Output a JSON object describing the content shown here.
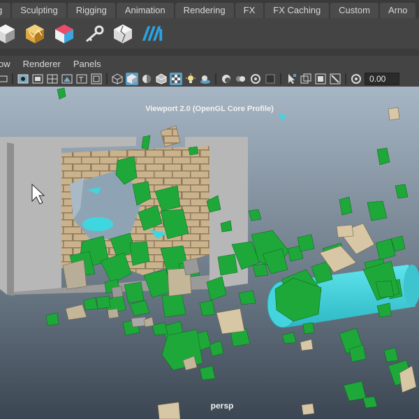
{
  "shelf_tabs": [
    "g",
    "Sculpting",
    "Rigging",
    "Animation",
    "Rendering",
    "FX",
    "FX Caching",
    "Custom",
    "Arno"
  ],
  "shelf_icons": [
    "cube-tool-icon",
    "gold-cube-icon",
    "multicolor-cube-icon",
    "key-icon",
    "cracked-cube-icon",
    "mash-icon"
  ],
  "panel_menu": [
    "ow",
    "Renderer",
    "Panels"
  ],
  "toolbar": {
    "field_value": "0.00"
  },
  "viewport": {
    "title": "Viewport 2.0 (OpenGL Core Profile)",
    "camera": "persp"
  },
  "colors": {
    "background_top": "#a7b6c4",
    "background_bottom": "#3b4652",
    "fragment_green": "#1fa83a",
    "wall_brick": "#c9b28c",
    "cylinder_cyan": "#3ed7e0"
  }
}
